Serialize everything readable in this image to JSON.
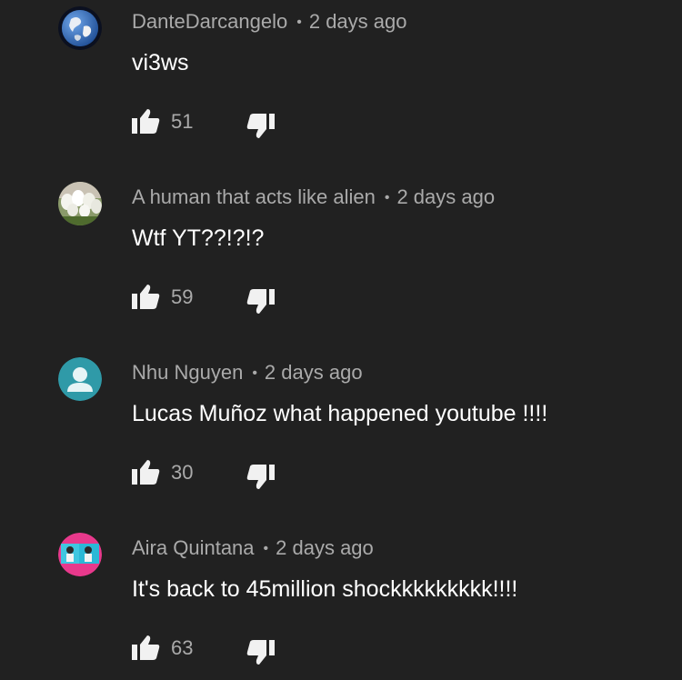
{
  "comments": [
    {
      "author": "DanteDarcangelo",
      "separator": "•",
      "time": "2 days ago",
      "text": "vi3ws",
      "likes": "51",
      "avatar_icon": "earth-globe-icon"
    },
    {
      "author": "A human that acts like alien",
      "separator": "•",
      "time": "2 days ago",
      "text": "Wtf YT??!?!?",
      "likes": "59",
      "avatar_icon": "white-tulips-icon"
    },
    {
      "author": "Nhu Nguyen",
      "separator": "•",
      "time": "2 days ago",
      "text": "Lucas Muñoz what happened youtube !!!!",
      "likes": "30",
      "avatar_icon": "default-user-icon",
      "avatar_color": "#2f9aa8"
    },
    {
      "author": "Aira Quintana",
      "separator": "•",
      "time": "2 days ago",
      "text": "It's back to 45million shockkkkkkkkk!!!!",
      "likes": "63",
      "avatar_icon": "photo-avatar-icon",
      "avatar_color": "#e8398c"
    }
  ],
  "colors": {
    "background": "#212121",
    "meta_text": "#aaaaaa",
    "body_text": "#ffffff",
    "icon": "#f1f1f1"
  }
}
